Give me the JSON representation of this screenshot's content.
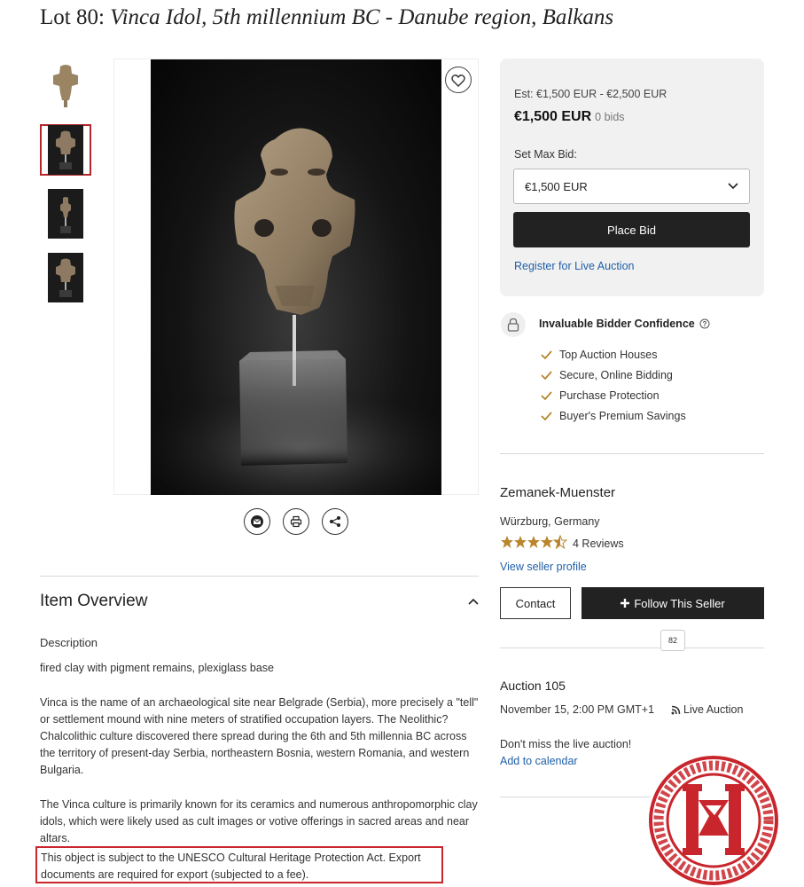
{
  "lot": {
    "prefix": "Lot 80: ",
    "title": "Vinca Idol, 5th millennium BC - Danube region, Balkans"
  },
  "thumbnails": [
    {
      "name": "thumbnail-1",
      "active": false
    },
    {
      "name": "thumbnail-2",
      "active": true
    },
    {
      "name": "thumbnail-3",
      "active": false
    },
    {
      "name": "thumbnail-4",
      "active": false
    }
  ],
  "image": {
    "alt": "Vinca clay idol on plexiglass stand"
  },
  "share": {
    "icons": [
      "email-icon",
      "print-icon",
      "share-icon"
    ]
  },
  "overview": {
    "title": "Item Overview",
    "description_label": "Description",
    "paragraphs": [
      "fired clay with pigment remains, plexiglass base",
      "Vinca is the name of an archaeological site near Belgrade (Serbia), more precisely a \"tell\" or settlement mound with nine meters of stratified occupation layers. The Neolithic?Chalcolithic culture discovered there spread during the 6th and 5th millennia BC across the territory of present-day Serbia, northeastern Bosnia, western Romania, and western Bulgaria.",
      "The Vinca culture is primarily known for its ceramics and numerous anthropomorphic clay idols, which were likely used as cult images or votive offerings in sacred areas and near altars."
    ],
    "notice": "This object is subject to the UNESCO Cultural Heritage Protection Act. Export documents are required for export (subjected to a fee)."
  },
  "bid": {
    "estimate": "Est: €1,500 EUR - €2,500 EUR",
    "current_price": "€1,500 EUR",
    "bids": "0 bids",
    "max_bid_label": "Set Max Bid:",
    "max_bid_value": "€1,500 EUR",
    "place_bid": "Place Bid",
    "register": "Register for Live Auction"
  },
  "confidence": {
    "title": "Invaluable Bidder Confidence",
    "items": [
      "Top Auction Houses",
      "Secure, Online Bidding",
      "Purchase Protection",
      "Buyer's Premium Savings"
    ]
  },
  "seller": {
    "name": "Zemanek-Muenster",
    "location": "Würzburg, Germany",
    "rating": 4.5,
    "reviews": "4 Reviews",
    "profile_link": "View seller profile",
    "contact": "Contact",
    "follow": "Follow This Seller",
    "followers": "82"
  },
  "auction": {
    "name": "Auction 105",
    "date": "November 15, 2:00 PM GMT+1",
    "type": "Live Auction",
    "reminder": "Don't miss the live auction!",
    "calendar": "Add to calendar"
  },
  "colors": {
    "accent_red": "#c8262c",
    "link_blue": "#1f5fa8",
    "star_gold": "#b9862e",
    "dark_button": "#222222"
  }
}
